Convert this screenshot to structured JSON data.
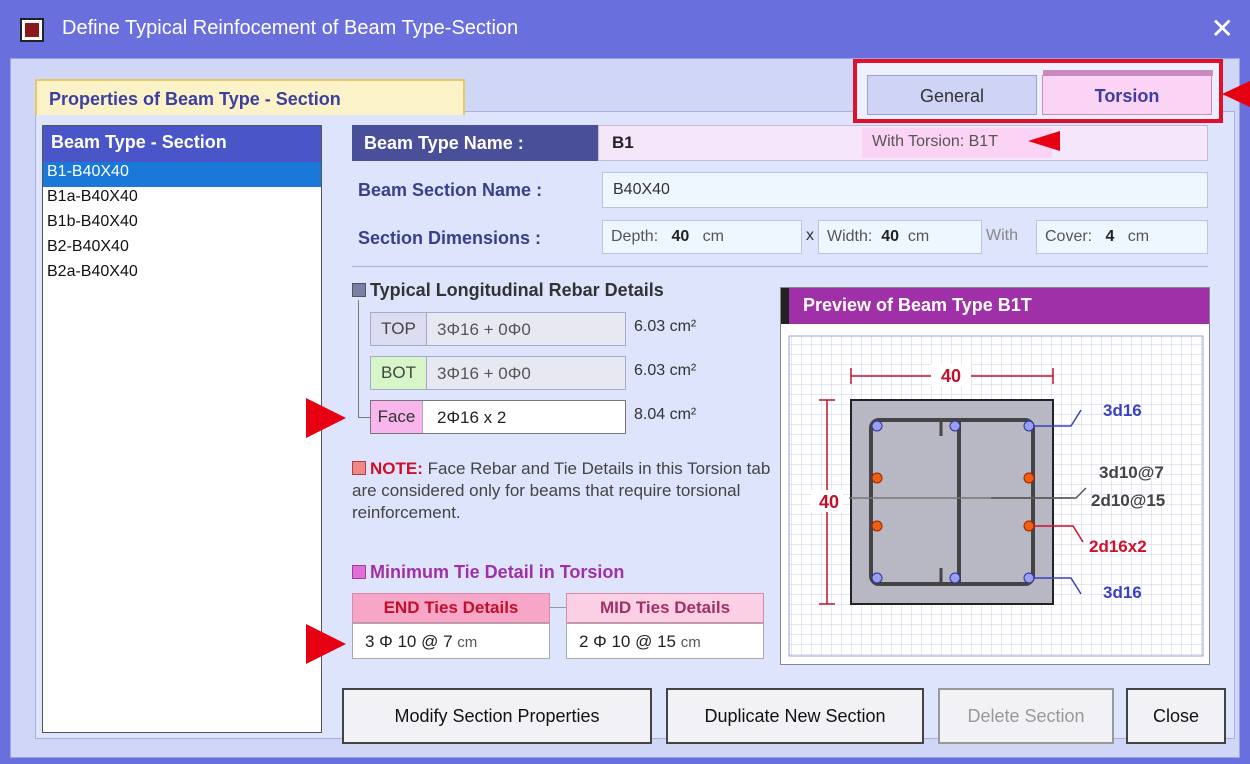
{
  "window": {
    "title": "Define Typical Reinfocement of Beam Type-Section",
    "close_glyph": "✕"
  },
  "tabs": {
    "properties_tab": "Properties of Beam Type - Section",
    "general": "General",
    "torsion": "Torsion"
  },
  "list": {
    "header": "Beam Type - Section",
    "items": [
      "B1-B40X40",
      "B1a-B40X40",
      "B1b-B40X40",
      "B2-B40X40",
      "B2a-B40X40"
    ],
    "selected_index": 0
  },
  "form": {
    "beam_type_name_label": "Beam Type Name :",
    "beam_type_name_value": "B1",
    "with_torsion": "With Torsion: B1T",
    "beam_section_name_label": "Beam Section Name :",
    "beam_section_name_value": "B40X40",
    "section_dimensions_label": "Section Dimensions :",
    "depth_label": "Depth:",
    "depth_value": "40",
    "depth_unit": "cm",
    "x_sep": "x",
    "width_label": "Width:",
    "width_value": "40",
    "width_unit": "cm",
    "with_label": "With",
    "cover_label": "Cover:",
    "cover_value": "4",
    "cover_unit": "cm"
  },
  "longitudinal": {
    "title": "Typical Longitudinal Rebar Details",
    "rows": [
      {
        "tag": "TOP",
        "value": "3Φ16 + 0Φ0",
        "area": "6.03 cm²"
      },
      {
        "tag": "BOT",
        "value": "3Φ16 + 0Φ0",
        "area": "6.03 cm²"
      },
      {
        "tag": "Face",
        "value": "2Φ16 x 2",
        "area": "8.04 cm²"
      }
    ]
  },
  "note": {
    "prefix": "NOTE:",
    "text": " Face Rebar and Tie Details in this Torsion tab are considered only for beams that require torsional reinforcement."
  },
  "ties": {
    "title": "Minimum Tie Detail in Torsion",
    "end_header": "END Ties Details",
    "end_value": "3 Φ 10 @ 7",
    "end_unit": "cm",
    "mid_header": "MID Ties Details",
    "mid_value": "2 Φ 10 @ 15",
    "mid_unit": "cm"
  },
  "preview": {
    "title": "Preview of Beam Type B1T",
    "width_dim": "40",
    "depth_dim": "40",
    "top_label": "3d16",
    "tie_label_1": "3d10@7",
    "tie_label_2": "2d10@15",
    "face_label": "2d16x2",
    "bot_label": "3d16"
  },
  "buttons": {
    "modify": "Modify Section Properties",
    "duplicate": "Duplicate New Section",
    "delete": "Delete Section",
    "close": "Close"
  },
  "colors": {
    "accent": "#e60012",
    "titlebar": "#6a6fde",
    "torsion_tab": "#fbd3f5"
  }
}
